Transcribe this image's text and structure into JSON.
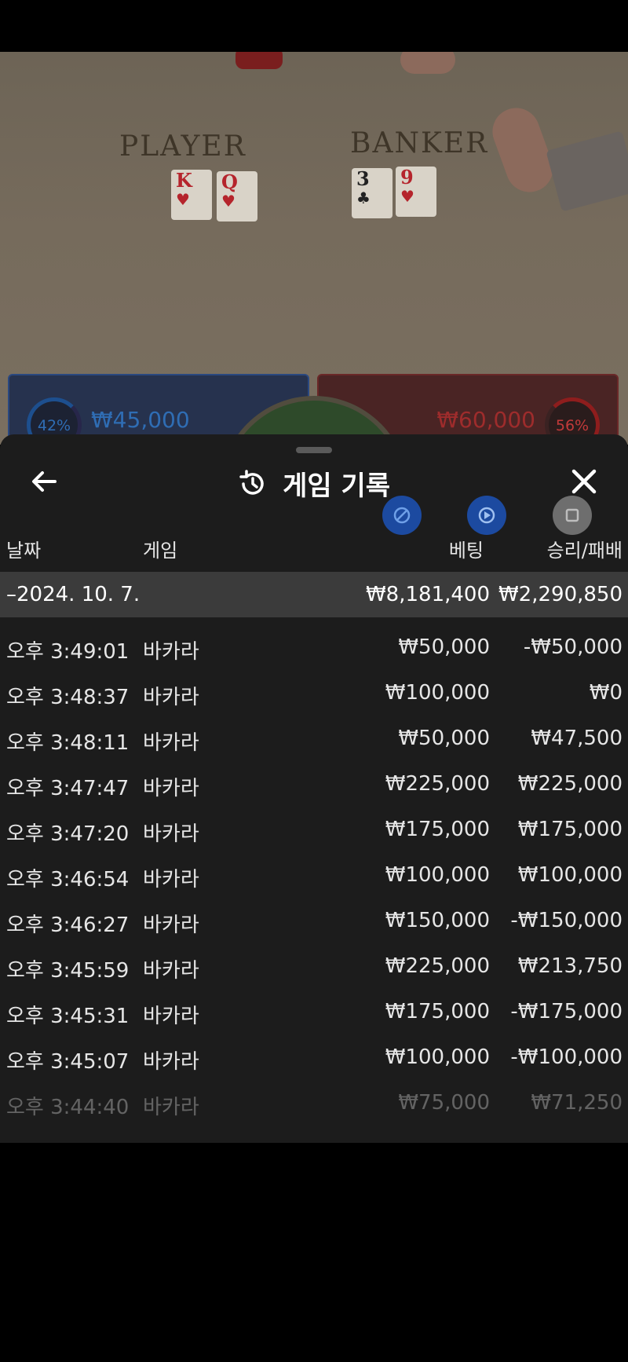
{
  "table": {
    "player_label": "PLAYER",
    "banker_label": "BANKER",
    "player_cards": [
      {
        "rank": "K",
        "suit": "♥"
      },
      {
        "rank": "Q",
        "suit": "♥"
      }
    ],
    "banker_cards": [
      {
        "rank": "3",
        "suit": "♣"
      },
      {
        "rank": "9",
        "suit": "♥"
      }
    ],
    "player_percent": "42%",
    "banker_percent": "56%",
    "player_amount": "₩45,000",
    "banker_amount": "₩60,000",
    "player_color": "#2f6db4",
    "banker_color": "#9e2c2c"
  },
  "sheet": {
    "title": "게임 기록",
    "title_icon": "history-icon",
    "back_icon": "arrow-left-icon",
    "close_icon": "close-icon",
    "columns": {
      "date": "날짜",
      "game": "게임",
      "bet": "베팅",
      "result": "승리/패배"
    },
    "day": {
      "label": "–2024. 10. 7.",
      "bet_total": "₩8,181,400",
      "result_total": "₩2,290,850"
    },
    "rows": [
      {
        "time": "오후 3:49:01",
        "game": "바카라",
        "bet": "₩50,000",
        "result": "-₩50,000"
      },
      {
        "time": "오후 3:48:37",
        "game": "바카라",
        "bet": "₩100,000",
        "result": "₩0"
      },
      {
        "time": "오후 3:48:11",
        "game": "바카라",
        "bet": "₩50,000",
        "result": "₩47,500"
      },
      {
        "time": "오후 3:47:47",
        "game": "바카라",
        "bet": "₩225,000",
        "result": "₩225,000"
      },
      {
        "time": "오후 3:47:20",
        "game": "바카라",
        "bet": "₩175,000",
        "result": "₩175,000"
      },
      {
        "time": "오후 3:46:54",
        "game": "바카라",
        "bet": "₩100,000",
        "result": "₩100,000"
      },
      {
        "time": "오후 3:46:27",
        "game": "바카라",
        "bet": "₩150,000",
        "result": "-₩150,000"
      },
      {
        "time": "오후 3:45:59",
        "game": "바카라",
        "bet": "₩225,000",
        "result": "₩213,750"
      },
      {
        "time": "오후 3:45:31",
        "game": "바카라",
        "bet": "₩175,000",
        "result": "-₩175,000"
      },
      {
        "time": "오후 3:45:07",
        "game": "바카라",
        "bet": "₩100,000",
        "result": "-₩100,000"
      },
      {
        "time": "오후 3:44:40",
        "game": "바카라",
        "bet": "₩75,000",
        "result": "₩71,250"
      }
    ]
  }
}
